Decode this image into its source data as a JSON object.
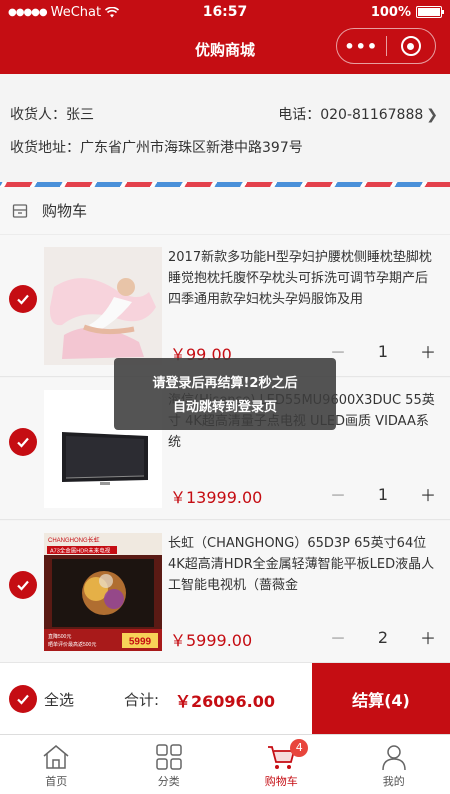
{
  "status_bar": {
    "carrier": "WeChat",
    "time": "16:57",
    "battery": "100%"
  },
  "nav": {
    "title": "优购商城"
  },
  "address": {
    "receiver": "收货人：张三",
    "phone": "电话：020-81167888",
    "detail": "收货地址：广东省广州市海珠区新港中路397号"
  },
  "cart": {
    "header": "购物车"
  },
  "items": [
    {
      "title": "2017新款多功能H型孕妇护腰枕侧睡枕垫脚枕睡觉抱枕托腹怀孕枕头可拆洗可调节孕期产后四季通用款孕妇枕头孕妈服饰及用",
      "price": "￥99.00",
      "qty": "1"
    },
    {
      "title": "海信(Hisense) LED55MU9600X3DUC 55英寸 4K超高清量子点电视 ULED画质 VIDAA系统",
      "price": "￥13999.00",
      "qty": "1"
    },
    {
      "title": "长虹（CHANGHONG）65D3P 65英寸64位4K超高清HDR全金属轻薄智能平板LED液晶人工智能电视机（蔷薇金",
      "price": "￥5999.00",
      "qty": "2"
    }
  ],
  "thumb3": {
    "brand": "CHANGHONG长虹",
    "banner": "A73全金属HDR未来电视",
    "price_tag": "5999",
    "promo1": "直降500元",
    "promo2": "晒单评价最高返500元"
  },
  "stepper": {
    "minus": "－",
    "plus": "＋"
  },
  "toast": {
    "line1": "请登录后再结算!2秒之后",
    "line2": "自动跳转到登录页"
  },
  "footer": {
    "select_all": "全选",
    "total_label": "合计:",
    "total_value": "￥26096.00",
    "checkout": "结算(4)"
  },
  "tabs": [
    {
      "label": "首页"
    },
    {
      "label": "分类"
    },
    {
      "label": "购物车",
      "badge": "4"
    },
    {
      "label": "我的"
    }
  ],
  "colors": {
    "brand": "#c50d13",
    "badge": "#e8453c"
  }
}
